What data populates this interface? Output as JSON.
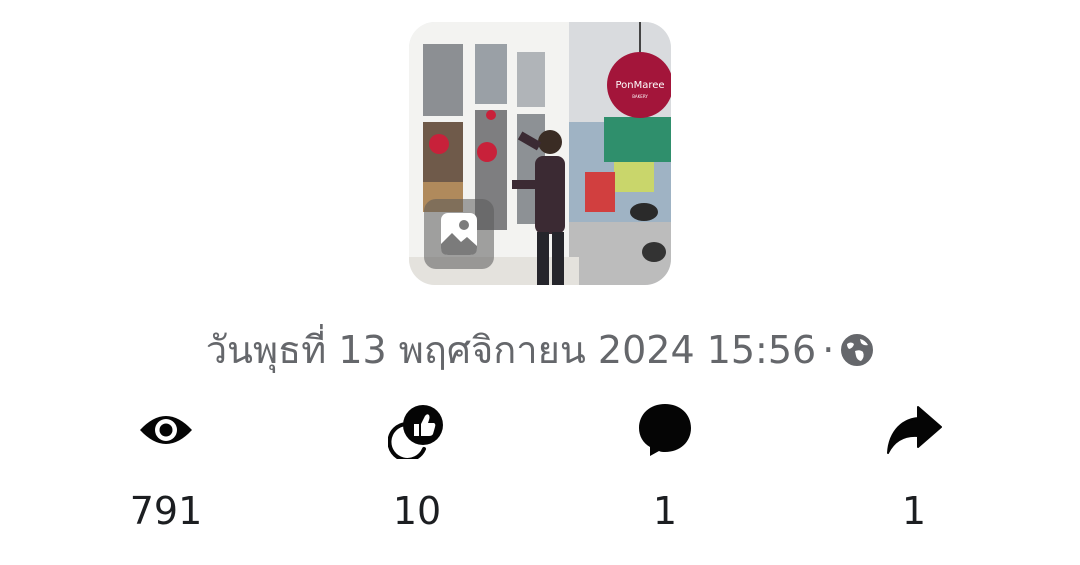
{
  "post": {
    "date_text": "วันพุธที่ 13 พฤศจิกายน  2024 15:56",
    "separator": "·",
    "privacy_icon": "globe-icon",
    "photo_badge_icon": "image-icon",
    "photo_sign_text": "PonMaree",
    "photo_sign_subtext": "BAKERY"
  },
  "stats": {
    "views": {
      "icon": "eye-icon",
      "count": "791"
    },
    "likes": {
      "icon": "thumbs-up-icon",
      "count": "10"
    },
    "comments": {
      "icon": "comment-icon",
      "count": "1"
    },
    "shares": {
      "icon": "share-icon",
      "count": "1"
    }
  },
  "colors": {
    "text_secondary": "#65676b",
    "text_primary": "#1c1e21",
    "icon": "#050505",
    "sign": "#a3153a"
  }
}
